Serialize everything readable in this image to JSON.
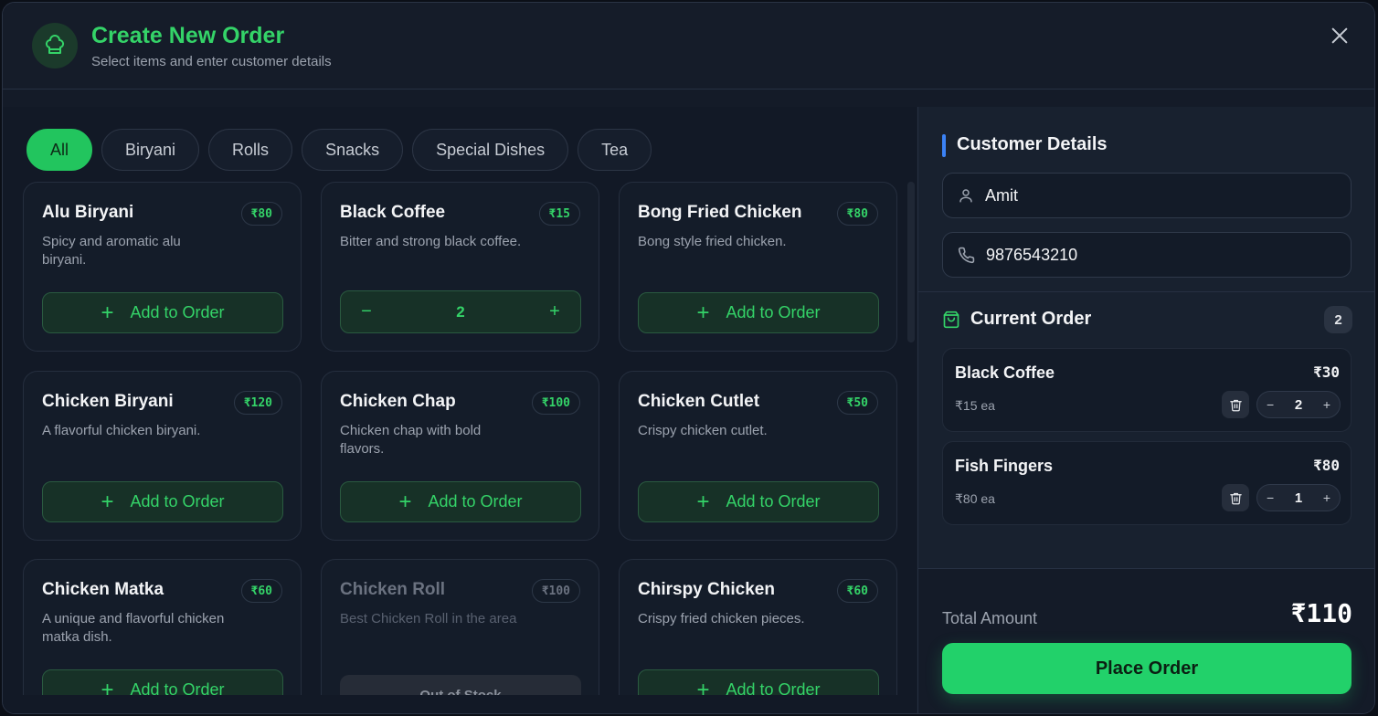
{
  "header": {
    "title": "Create New Order",
    "subtitle": "Select items and enter customer details",
    "close_icon": "close-icon",
    "chef_icon": "chef-hat-icon"
  },
  "tabs": [
    "All",
    "Biryani",
    "Rolls",
    "Snacks",
    "Special Dishes",
    "Tea"
  ],
  "active_tab": "All",
  "menu": {
    "add_label": "Add to Order",
    "out_of_stock_label": "Out of Stock",
    "items": [
      {
        "name": "Alu Biryani",
        "price": "₹80",
        "desc": "Spicy and aromatic alu biryani.",
        "state": "add"
      },
      {
        "name": "Black Coffee",
        "price": "₹15",
        "desc": "Bitter and strong black coffee.",
        "state": "qty",
        "qty": "2"
      },
      {
        "name": "Bong Fried Chicken",
        "price": "₹80",
        "desc": "Bong style fried chicken.",
        "state": "add"
      },
      {
        "name": "Chicken Biryani",
        "price": "₹120",
        "desc": "A flavorful chicken biryani.",
        "state": "add"
      },
      {
        "name": "Chicken Chap",
        "price": "₹100",
        "desc": "Chicken chap with bold flavors.",
        "state": "add"
      },
      {
        "name": "Chicken Cutlet",
        "price": "₹50",
        "desc": "Crispy chicken cutlet.",
        "state": "add"
      },
      {
        "name": "Chicken Matka",
        "price": "₹60",
        "desc": "A unique and flavorful chicken matka dish.",
        "state": "add"
      },
      {
        "name": "Chicken Roll",
        "price": "₹100",
        "desc": "Best Chicken Roll in the area",
        "state": "oos"
      },
      {
        "name": "Chirspy Chicken",
        "price": "₹60",
        "desc": "Crispy fried chicken pieces.",
        "state": "add"
      }
    ]
  },
  "customer": {
    "title": "Customer Details",
    "name": "Amit",
    "phone": "9876543210"
  },
  "order": {
    "title": "Current Order",
    "count": "2",
    "items": [
      {
        "name": "Black Coffee",
        "total": "₹30",
        "each": "₹15 ea",
        "qty": "2"
      },
      {
        "name": "Fish Fingers",
        "total": "₹80",
        "each": "₹80 ea",
        "qty": "1"
      }
    ]
  },
  "footer": {
    "total_label": "Total Amount",
    "total_value": "₹110",
    "place_label": "Place Order"
  },
  "colors": {
    "accent": "#22c55e",
    "background": "#141b28",
    "section_bar": "#3b82f6"
  }
}
